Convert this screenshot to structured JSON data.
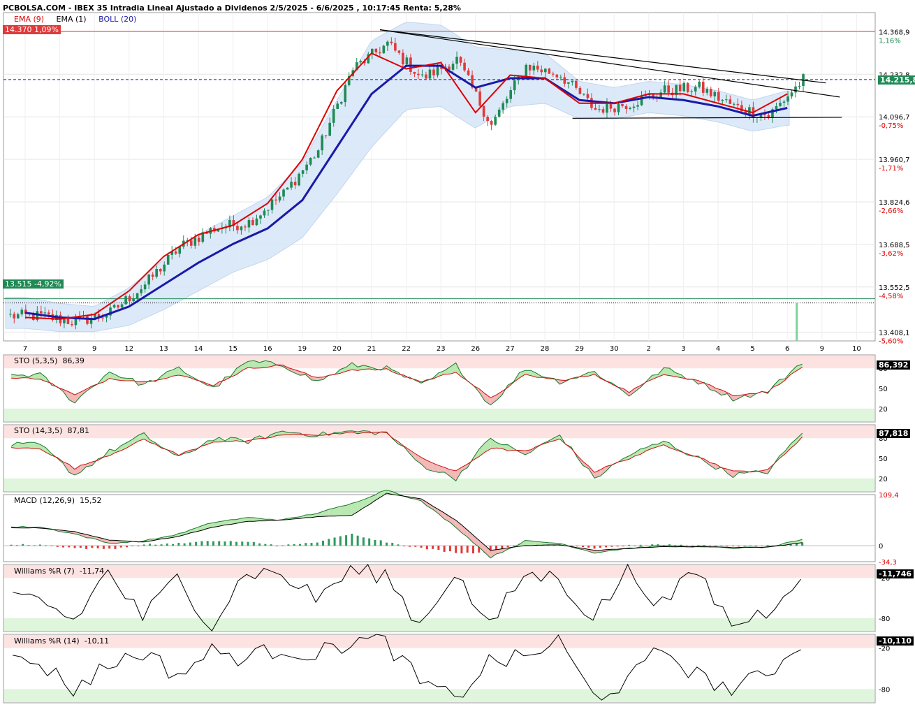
{
  "header": {
    "title": "PCBOLSA.COM - IBEX 35 Intradia Lineal Ajustado a Dividenos 2/5/2025 - 6/6/2025 , 10:17:45 Renta: 5,28%"
  },
  "legend": {
    "ema9": "EMA (9)",
    "ema1": "EMA (1)",
    "boll": "BOLL (20)"
  },
  "colors": {
    "ema9": "#dd0000",
    "ema1": "#000000",
    "boll": "#1a1aa8",
    "bollFill": "#d6e6f8",
    "up": "#1f8a55",
    "down": "#e03a3a",
    "oscUpFill": "#b9e8b0",
    "oscDownFill": "#f3b8b8",
    "zoneTop": "#fde2e2",
    "zoneBottom": "#dff5dc",
    "pctPos": "#1f8a55",
    "pctNeg": "#dd0000"
  },
  "price_tags": {
    "high_tag": "14.370  1,09%",
    "low_tag": "13.515  -4,92%",
    "last_tag": "14.215,8"
  },
  "chart_data": [
    {
      "type": "candlestick",
      "title": "IBEX 35",
      "y_axis": {
        "ticks": [
          {
            "value": "14.368,9",
            "pct": "1,16%"
          },
          {
            "value": "14.232,8",
            "pct": ""
          },
          {
            "value": "14.096,7",
            "pct": "-0,75%"
          },
          {
            "value": "13.960,7",
            "pct": "-1,71%"
          },
          {
            "value": "13.824,6",
            "pct": "-2,66%"
          },
          {
            "value": "13.688,5",
            "pct": "-3,62%"
          },
          {
            "value": "13.552,5",
            "pct": "-4,58%"
          },
          {
            "value": "13.408,1",
            "pct": "-5,60%"
          }
        ],
        "ylim": [
          13380,
          14430
        ]
      },
      "x_axis": {
        "tick_labels": [
          "7",
          "8",
          "9",
          "12",
          "13",
          "14",
          "15",
          "16",
          "19",
          "20",
          "21",
          "22",
          "23",
          "26",
          "27",
          "28",
          "29",
          "30",
          "2",
          "3",
          "4",
          "5",
          "6",
          "9",
          "10"
        ]
      },
      "daily_close": [
        13460,
        13440,
        13470,
        13560,
        13680,
        13740,
        13760,
        13850,
        13990,
        14250,
        14330,
        14220,
        14280,
        14070,
        14260,
        14230,
        14120,
        14140,
        14180,
        14190,
        14130,
        14100,
        14215.8
      ],
      "reference_lines": {
        "high": 14370,
        "low": 13515,
        "last": 14215.8
      },
      "series": [
        {
          "name": "EMA (9)",
          "values": [
            13455,
            13450,
            13465,
            13540,
            13650,
            13720,
            13750,
            13820,
            13960,
            14180,
            14300,
            14250,
            14270,
            14110,
            14230,
            14220,
            14140,
            14140,
            14170,
            14170,
            14140,
            14110,
            14170
          ]
        },
        {
          "name": "BOLL (20)",
          "values": [
            13470,
            13455,
            13450,
            13490,
            13560,
            13630,
            13690,
            13740,
            13830,
            14000,
            14170,
            14260,
            14260,
            14190,
            14220,
            14220,
            14150,
            14140,
            14160,
            14150,
            14130,
            14100,
            14125
          ]
        }
      ]
    },
    {
      "type": "line",
      "title": "STO (5,3,5)",
      "value": "86,39",
      "last_tag": "86,392",
      "levels": [
        "80",
        "50",
        "20"
      ],
      "ylim": [
        0,
        100
      ],
      "series": [
        {
          "name": "%K",
          "values": [
            70,
            30,
            75,
            55,
            80,
            50,
            90,
            85,
            60,
            85,
            80,
            55,
            85,
            25,
            80,
            60,
            75,
            40,
            80,
            60,
            35,
            45,
            90
          ]
        },
        {
          "name": "%D",
          "values": [
            65,
            40,
            65,
            60,
            70,
            55,
            80,
            85,
            65,
            78,
            78,
            60,
            75,
            35,
            70,
            62,
            70,
            45,
            72,
            62,
            40,
            45,
            82
          ]
        }
      ]
    },
    {
      "type": "line",
      "title": "STO (14,3,5)",
      "value": "87,81",
      "last_tag": "87,818",
      "levels": [
        "80",
        "50",
        "20"
      ],
      "ylim": [
        0,
        100
      ],
      "series": [
        {
          "name": "%K",
          "values": [
            70,
            25,
            60,
            85,
            50,
            80,
            75,
            90,
            85,
            90,
            88,
            40,
            20,
            80,
            55,
            85,
            20,
            55,
            75,
            50,
            25,
            30,
            90
          ]
        },
        {
          "name": "%D",
          "values": [
            65,
            35,
            55,
            78,
            55,
            75,
            75,
            85,
            85,
            88,
            88,
            50,
            30,
            65,
            60,
            80,
            30,
            50,
            70,
            52,
            30,
            32,
            82
          ]
        }
      ]
    },
    {
      "type": "line",
      "title": "MACD (12,26,9)",
      "value": "15,52",
      "ticks": [
        "109,4",
        "0",
        "-34,3"
      ],
      "ylim": [
        -34.3,
        109.4
      ],
      "series": [
        {
          "name": "MACD",
          "values": [
            40,
            25,
            5,
            10,
            25,
            50,
            60,
            55,
            70,
            90,
            120,
            95,
            40,
            -25,
            10,
            5,
            -15,
            -5,
            0,
            -2,
            -5,
            -3,
            12
          ]
        },
        {
          "name": "Signal",
          "values": [
            38,
            30,
            12,
            8,
            20,
            40,
            52,
            55,
            62,
            65,
            112,
            100,
            55,
            -10,
            0,
            2,
            -10,
            -6,
            -2,
            -2,
            -4,
            -3,
            6
          ]
        }
      ]
    },
    {
      "type": "line",
      "title": "Williams %R (7)",
      "value": "-11,74",
      "last_tag": "-11,746",
      "levels": [
        "-20",
        "-80"
      ],
      "ylim": [
        -100,
        0
      ],
      "series": [
        {
          "name": "Williams %R (7)",
          "values": [
            -50,
            -85,
            -10,
            -80,
            -20,
            -90,
            -10,
            -15,
            -50,
            -10,
            -15,
            -90,
            -10,
            -95,
            -15,
            -20,
            -80,
            -10,
            -60,
            -10,
            -90,
            -70,
            -11.74
          ]
        }
      ]
    },
    {
      "type": "line",
      "title": "Williams %R (14)",
      "value": "-10,11",
      "last_tag": "-10,110",
      "levels": [
        "-20",
        "-80"
      ],
      "ylim": [
        -100,
        0
      ],
      "series": [
        {
          "name": "Williams %R (14)",
          "values": [
            -40,
            -80,
            -45,
            -25,
            -60,
            -25,
            -35,
            -20,
            -30,
            -10,
            -10,
            -70,
            -95,
            -40,
            -35,
            -10,
            -90,
            -70,
            -20,
            -60,
            -80,
            -60,
            -10.11
          ]
        }
      ]
    }
  ]
}
